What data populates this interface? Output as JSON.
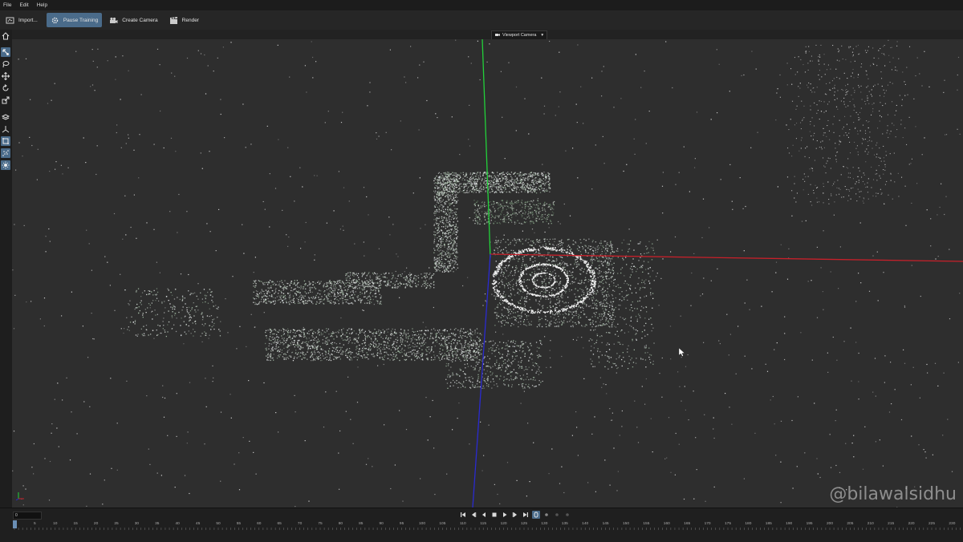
{
  "menu": {
    "items": [
      "File",
      "Edit",
      "Help"
    ]
  },
  "toolbar": {
    "import_label": "Import...",
    "pause_label": "Pause Training",
    "create_camera_label": "Create Camera",
    "render_label": "Render"
  },
  "camera_selector": {
    "label": "Viewport Camera",
    "chevron": "▾"
  },
  "left_tools": [
    {
      "icon": "home-icon"
    },
    {
      "icon": "select-icon",
      "selected": true
    },
    {
      "icon": "lasso-icon"
    },
    {
      "icon": "move-icon"
    },
    {
      "icon": "rotate-icon"
    },
    {
      "icon": "scale-icon"
    },
    {
      "icon": "layers-icon"
    },
    {
      "icon": "axis-icon"
    },
    {
      "icon": "crop-icon",
      "selected": true
    },
    {
      "icon": "points-icon",
      "selected": true
    },
    {
      "icon": "light-icon",
      "selected": true
    }
  ],
  "timeline": {
    "frame_value": "0",
    "ticks": [
      "0",
      "5",
      "10",
      "15",
      "20",
      "25",
      "30",
      "35",
      "40",
      "45",
      "50",
      "55",
      "60",
      "65",
      "70",
      "75",
      "80",
      "85",
      "90",
      "95",
      "100",
      "105",
      "110",
      "115",
      "120",
      "125",
      "130",
      "135",
      "140",
      "145",
      "150",
      "155",
      "160",
      "165",
      "170",
      "175",
      "180",
      "185",
      "190",
      "195",
      "200",
      "205",
      "210",
      "215",
      "220",
      "225",
      "230"
    ],
    "transport": [
      "skip-start-icon",
      "prev-keyframe-icon",
      "step-back-icon",
      "stop-icon",
      "play-icon",
      "step-forward-icon",
      "skip-end-icon",
      "loop-icon",
      "dot-icon",
      "dot-icon",
      "dot-icon"
    ]
  },
  "watermark": "@bilawalsidhu",
  "colors": {
    "accent": "#4a6b8a",
    "x_axis": "#c8202a",
    "y_axis": "#22d13a",
    "z_axis": "#2a2ad0"
  }
}
